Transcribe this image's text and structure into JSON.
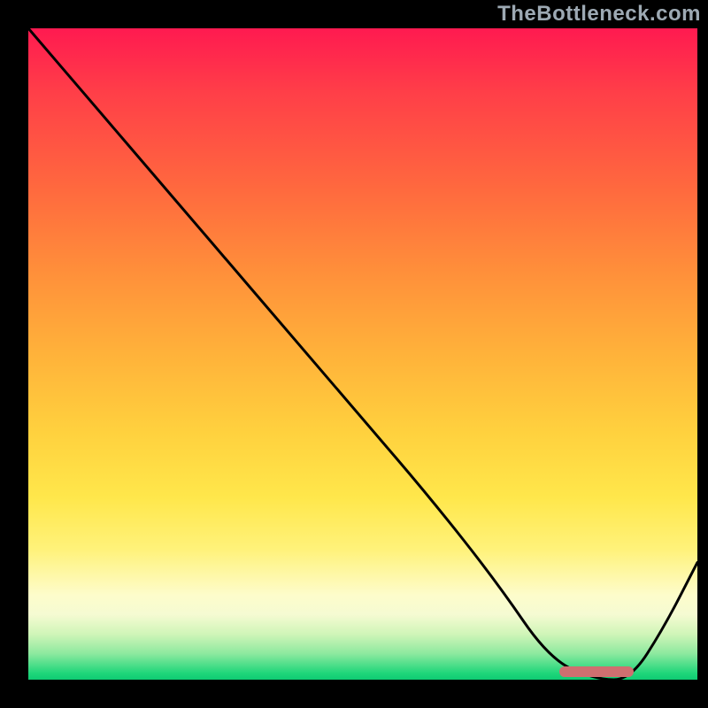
{
  "chart_data": {
    "type": "line",
    "title": "",
    "xlabel": "",
    "ylabel": "",
    "xlim": [
      0,
      100
    ],
    "ylim": [
      0,
      100
    ],
    "x": [
      0,
      10,
      20,
      25,
      30,
      40,
      50,
      60,
      70,
      78,
      85,
      90,
      95,
      100
    ],
    "values": [
      100,
      88,
      76,
      70,
      64,
      52,
      40,
      28,
      15,
      3,
      0,
      0,
      8,
      18
    ],
    "marker_range": [
      79,
      90
    ],
    "watermark": "TheBottleneck.com"
  },
  "colors": {
    "curve": "#000000",
    "marker": "#cf6f70",
    "watermark": "#9da9b3",
    "gradient_stops": [
      {
        "pos": 0,
        "hex": "#ff1a50"
      },
      {
        "pos": 25,
        "hex": "#ff6a3e"
      },
      {
        "pos": 50,
        "hex": "#ffb23a"
      },
      {
        "pos": 72,
        "hex": "#ffe74b"
      },
      {
        "pos": 90,
        "hex": "#f5fbd2"
      },
      {
        "pos": 100,
        "hex": "#0fcb73"
      }
    ]
  }
}
